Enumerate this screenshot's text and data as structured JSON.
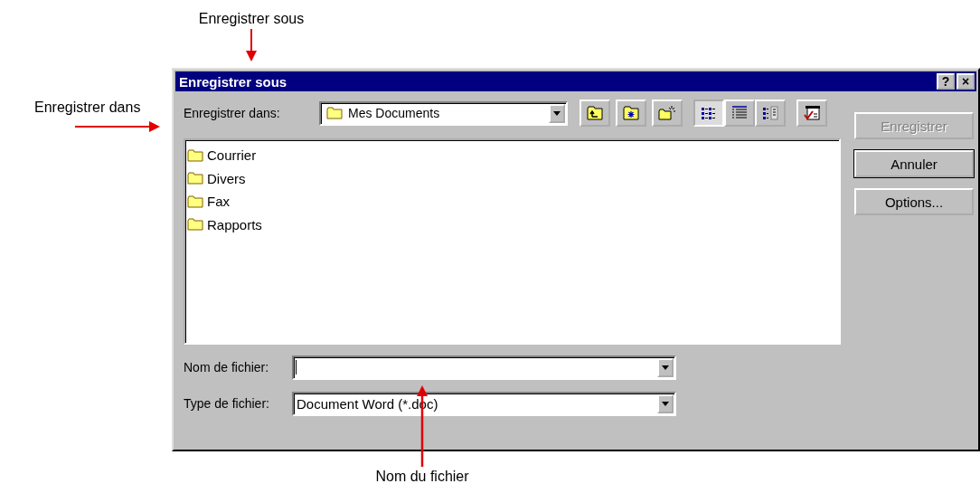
{
  "annotations": [
    {
      "kind": "down",
      "text": "Enregistrer sous"
    },
    {
      "kind": "right",
      "text": "Enregistrer dans"
    },
    {
      "kind": "up",
      "text": "Nom du fichier"
    }
  ],
  "window": {
    "title": "Enregistrer sous",
    "title_buttons": [
      "?",
      "×"
    ]
  },
  "save_in": {
    "label": "Enregistrer dans:",
    "value": "Mes Documents"
  },
  "toolbar": [
    {
      "kind": "up-folder",
      "selected": false
    },
    {
      "kind": "favorites",
      "selected": false
    },
    {
      "kind": "new-folder",
      "selected": false
    },
    {
      "kind": "list-view",
      "selected": true
    },
    {
      "kind": "details-view",
      "selected": false
    },
    {
      "kind": "properties-view",
      "selected": false
    },
    {
      "kind": "commands",
      "selected": false
    }
  ],
  "files": [
    {
      "name": "Courrier"
    },
    {
      "name": "Divers"
    },
    {
      "name": "Fax"
    },
    {
      "name": "Rapports"
    }
  ],
  "buttons": [
    {
      "label": "Enregistrer",
      "disabled": true,
      "default": false
    },
    {
      "label": "Annuler",
      "disabled": false,
      "default": true
    },
    {
      "label": "Options...",
      "disabled": false,
      "default": false
    }
  ],
  "file_name": {
    "label": "Nom de fichier:"
  },
  "file_type": {
    "label": "Type de fichier:",
    "value": "Document Word (*.doc)"
  }
}
